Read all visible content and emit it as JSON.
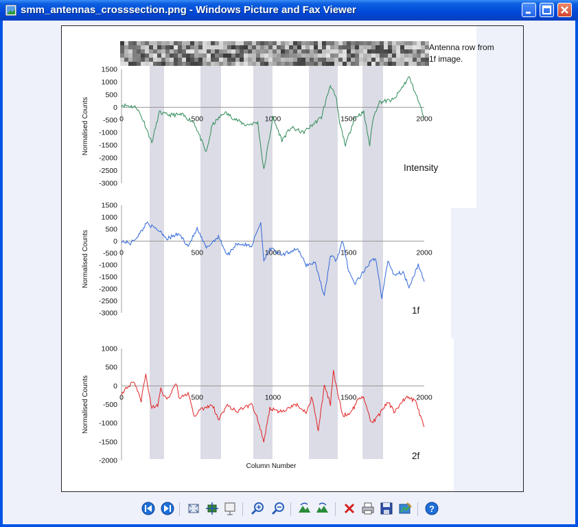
{
  "window": {
    "title": "smm_antennas_crosssection.png - Windows Picture and Fax Viewer"
  },
  "figure": {
    "strip_caption_line1": "Antenna row from",
    "strip_caption_line2": "1f image.",
    "x_axis_title": "Column Number",
    "y_axis_title": "Normalised Counts",
    "x_ticks": [
      "0",
      "500",
      "1000",
      "1500",
      "2000"
    ]
  },
  "chart_data": [
    {
      "type": "line",
      "panel_label": "Intensity",
      "series_color": "#2e8b57",
      "ylim": [
        -3000,
        1500
      ],
      "xlim": [
        0,
        2000
      ],
      "y_ticks": [
        "1500",
        "1000",
        "500",
        "0",
        "-500",
        "-1000",
        "-1500",
        "-2000",
        "-2500",
        "-3000"
      ],
      "x": [
        0,
        100,
        150,
        200,
        250,
        300,
        400,
        480,
        560,
        600,
        680,
        760,
        820,
        900,
        940,
        960,
        1000,
        1060,
        1120,
        1200,
        1260,
        1320,
        1380,
        1420,
        1440,
        1480,
        1540,
        1600,
        1640,
        1660,
        1700,
        1800,
        1900,
        1940,
        2000
      ],
      "y": [
        100,
        0,
        -600,
        -1400,
        -200,
        -300,
        -300,
        -600,
        -1800,
        -700,
        -200,
        -500,
        -700,
        -600,
        -2500,
        -1800,
        -400,
        -1300,
        -800,
        -1000,
        -700,
        -400,
        900,
        300,
        -600,
        -1500,
        -400,
        -200,
        -1500,
        -500,
        200,
        300,
        1200,
        600,
        -400
      ]
    },
    {
      "type": "line",
      "panel_label": "1f",
      "series_color": "#2f66d8",
      "ylim": [
        -3000,
        1500
      ],
      "xlim": [
        0,
        2000
      ],
      "y_ticks": [
        "1500",
        "1000",
        "500",
        "0",
        "-500",
        "-1000",
        "-1500",
        "-2000",
        "-2500",
        "-3000"
      ],
      "x": [
        0,
        60,
        120,
        170,
        200,
        260,
        300,
        380,
        440,
        500,
        560,
        640,
        700,
        760,
        860,
        920,
        940,
        980,
        1060,
        1160,
        1220,
        1280,
        1340,
        1380,
        1420,
        1460,
        1500,
        1540,
        1600,
        1640,
        1680,
        1720,
        1760,
        1800,
        1860,
        1900,
        1960,
        2000
      ],
      "y": [
        0,
        -100,
        300,
        800,
        600,
        400,
        100,
        300,
        -200,
        500,
        -300,
        200,
        -600,
        -100,
        -200,
        800,
        -800,
        -300,
        -600,
        -300,
        -1000,
        -900,
        -2300,
        -600,
        -800,
        0,
        -1200,
        -1800,
        -1300,
        -900,
        -700,
        -2400,
        -800,
        -1400,
        -1300,
        -1900,
        -1000,
        -1700
      ]
    },
    {
      "type": "line",
      "panel_label": "2f",
      "series_color": "#e02020",
      "ylim": [
        -2000,
        1000
      ],
      "xlim": [
        0,
        2000
      ],
      "y_ticks": [
        "1000",
        "500",
        "0",
        "-500",
        "-1000",
        "-1500",
        "-2000"
      ],
      "x": [
        0,
        80,
        130,
        160,
        200,
        240,
        260,
        300,
        360,
        380,
        440,
        480,
        540,
        600,
        640,
        700,
        760,
        800,
        860,
        900,
        940,
        980,
        1040,
        1100,
        1160,
        1220,
        1260,
        1300,
        1340,
        1380,
        1400,
        1460,
        1520,
        1560,
        1600,
        1650,
        1700,
        1760,
        1800,
        1880,
        1940,
        2000
      ],
      "y": [
        -200,
        100,
        -400,
        300,
        -600,
        -500,
        -100,
        -400,
        100,
        -300,
        -200,
        -800,
        -600,
        -500,
        -900,
        -500,
        -700,
        -600,
        -500,
        -900,
        -1500,
        -600,
        -700,
        -600,
        -500,
        -700,
        -300,
        -1200,
        0,
        -500,
        400,
        -800,
        -700,
        -400,
        -300,
        -1000,
        -800,
        -400,
        -700,
        -300,
        -400,
        -1100
      ]
    }
  ],
  "toolbar": {
    "icons": [
      "previous-image-icon",
      "next-image-icon",
      "best-fit-icon",
      "actual-size-icon",
      "slideshow-icon",
      "zoom-in-icon",
      "zoom-out-icon",
      "rotate-clockwise-icon",
      "rotate-counterclockwise-icon",
      "delete-icon",
      "print-icon",
      "save-icon",
      "edit-icon",
      "help-icon"
    ]
  }
}
